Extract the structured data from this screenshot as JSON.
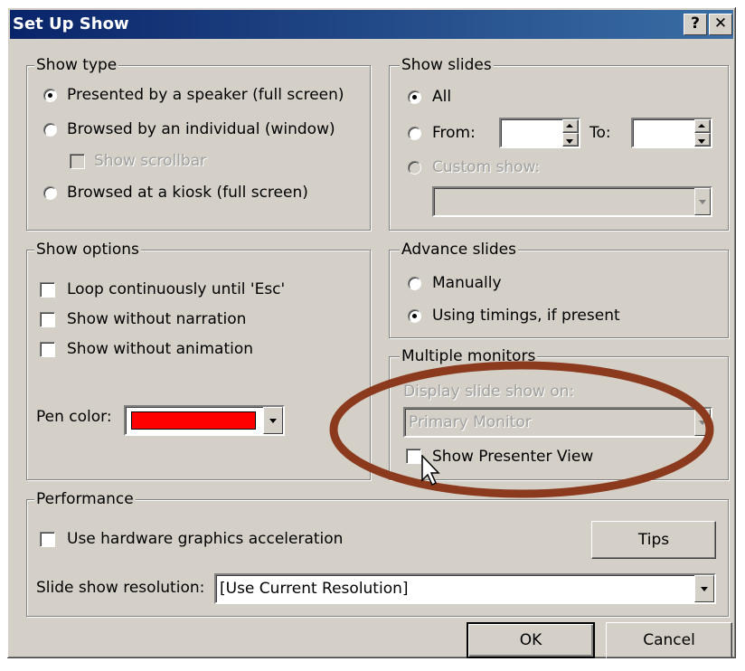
{
  "window": {
    "title": "Set Up Show",
    "help_label": "?",
    "close_label": "✕",
    "help_icon": "help-icon",
    "close_icon": "close-icon"
  },
  "show_type": {
    "label": "Show type",
    "options": [
      {
        "label": "Presented by a speaker (full screen)",
        "selected": true
      },
      {
        "label": "Browsed by an individual (window)",
        "selected": false
      },
      {
        "label": "Browsed at a kiosk (full screen)",
        "selected": false
      }
    ],
    "show_scrollbar": {
      "label": "Show scrollbar",
      "checked": false,
      "enabled": false
    }
  },
  "show_slides": {
    "label": "Show slides",
    "all_label": "All",
    "from_label": "From:",
    "to_label": "To:",
    "from_value": "",
    "to_value": "",
    "custom_label": "Custom show:",
    "custom_value": "",
    "selected": "All"
  },
  "show_options": {
    "label": "Show options",
    "items": [
      {
        "label": "Loop continuously until 'Esc'",
        "checked": false
      },
      {
        "label": "Show without narration",
        "checked": false
      },
      {
        "label": "Show without animation",
        "checked": false
      }
    ],
    "pen_color_label": "Pen color:",
    "pen_color": "#ff0000"
  },
  "advance_slides": {
    "label": "Advance slides",
    "options": [
      {
        "label": "Manually",
        "selected": false
      },
      {
        "label": "Using timings, if present",
        "selected": true
      }
    ]
  },
  "multiple_monitors": {
    "label": "Multiple monitors",
    "display_label": "Display slide show on:",
    "display_value": "Primary Monitor",
    "presenter_view_label": "Show Presenter View",
    "presenter_view_checked": false
  },
  "performance": {
    "label": "Performance",
    "hardware_accel_label": "Use hardware graphics acceleration",
    "hardware_accel_checked": false,
    "tips_label": "Tips",
    "resolution_label": "Slide show resolution:",
    "resolution_value": "[Use Current Resolution]"
  },
  "buttons": {
    "ok": "OK",
    "cancel": "Cancel"
  },
  "annotation": {
    "color": "#8b3a1e"
  },
  "colors": {
    "title_start": "#0a246a",
    "title_end": "#3a6ea5",
    "face": "#d4d0c8"
  }
}
